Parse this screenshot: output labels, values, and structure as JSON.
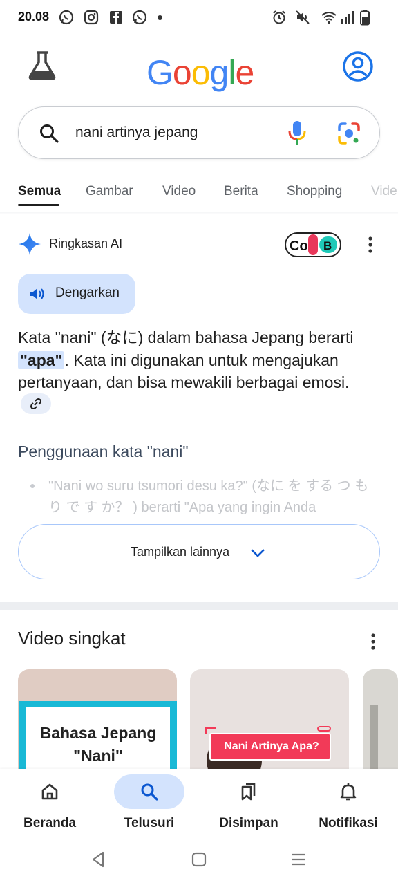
{
  "status_bar": {
    "time": "20.08",
    "left_icons": [
      "whatsapp-icon",
      "instagram-icon",
      "facebook-icon",
      "whatsapp-icon"
    ],
    "right_icons": [
      "alarm-icon",
      "mute-icon",
      "wifi-icon",
      "signal-icon",
      "battery-icon"
    ]
  },
  "header": {
    "logo_letters": [
      "G",
      "o",
      "o",
      "g",
      "l",
      "e"
    ],
    "logo_colors": [
      "#4285f4",
      "#ea4335",
      "#fbbc05",
      "#4285f4",
      "#34a853",
      "#ea4335"
    ],
    "labs_icon": "flask-icon",
    "account_icon": "account-icon",
    "accent": "#1a73e8"
  },
  "search": {
    "query": "nani artinya jepang",
    "icons": [
      "search-icon",
      "mic-icon",
      "lens-icon"
    ]
  },
  "tabs": [
    {
      "label": "Semua",
      "active": true
    },
    {
      "label": "Gambar",
      "active": false
    },
    {
      "label": "Video",
      "active": false
    },
    {
      "label": "Berita",
      "active": false
    },
    {
      "label": "Shopping",
      "active": false
    },
    {
      "label": "Vide",
      "active": false
    }
  ],
  "ai_overview": {
    "title": "Ringkasan AI",
    "source_logo": "CoUB",
    "listen_label": "Dengarkan",
    "body_part1": "Kata \"nani\" (なに) dalam bahasa Jepang berarti ",
    "body_highlight": "\"apa\"",
    "body_part2": ". Kata ini digunakan untuk mengajukan pertanyaan, dan bisa mewakili berbagai emosi.",
    "usage_heading": "Penggunaan kata \"nani\"",
    "faded_bullet": "\"Nani wo suru tsumori desu ka?\" (なに を する つ もり で す か？ ) berarti \"Apa yang ingin Anda",
    "show_more_label": "Tampilkan lainnya"
  },
  "short_videos": {
    "heading": "Video singkat",
    "cards": [
      {
        "overlay_text_line1": "Bahasa Jepang",
        "overlay_text_line2": "\"Nani\""
      },
      {
        "overlay_text": "Nani Artinya Apa?"
      },
      {}
    ]
  },
  "bottom_nav": [
    {
      "label": "Beranda",
      "icon": "home-icon",
      "active": false
    },
    {
      "label": "Telusuri",
      "icon": "search-icon",
      "active": true
    },
    {
      "label": "Disimpan",
      "icon": "bookmarks-icon",
      "active": false
    },
    {
      "label": "Notifikasi",
      "icon": "bell-icon",
      "active": false
    }
  ],
  "system_nav": [
    "back-icon",
    "home-square-icon",
    "recents-menu-icon"
  ]
}
